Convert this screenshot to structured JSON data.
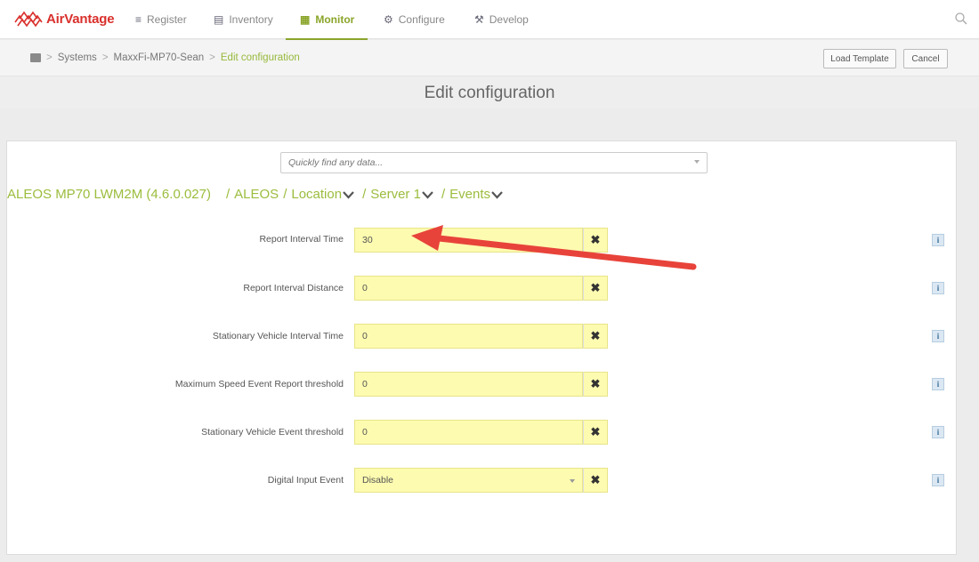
{
  "nav": {
    "logo": "AirVantage",
    "items": [
      {
        "label": "Register",
        "icon": "register-icon"
      },
      {
        "label": "Inventory",
        "icon": "inventory-icon"
      },
      {
        "label": "Monitor",
        "icon": "monitor-icon",
        "active": true
      },
      {
        "label": "Configure",
        "icon": "gear-icon"
      },
      {
        "label": "Develop",
        "icon": "tools-icon"
      }
    ],
    "search_icon": "search-icon",
    "accent_color": "#8aa52a",
    "brand_color": "#d9302c"
  },
  "breadcrumb": {
    "items": [
      "Systems",
      "MaxxFi-MP70-Sean"
    ],
    "current": "Edit configuration",
    "separator": ">"
  },
  "actions": {
    "load_template": "Load Template",
    "cancel": "Cancel"
  },
  "page_title": "Edit configuration",
  "search": {
    "placeholder": "Quickly find any data..."
  },
  "path": {
    "root": "ALEOS MP70 LWM2M (4.6.0.027)",
    "segments": [
      "ALEOS",
      "Location",
      "Server 1",
      "Events"
    ]
  },
  "fields": [
    {
      "label": "Report Interval Time",
      "value": "30"
    },
    {
      "label": "Report Interval Distance",
      "value": "0"
    },
    {
      "label": "Stationary Vehicle Interval Time",
      "value": "0"
    },
    {
      "label": "Maximum Speed Event Report threshold",
      "value": "0"
    },
    {
      "label": "Stationary Vehicle Event threshold",
      "value": "0"
    },
    {
      "label": "Digital Input Event",
      "value": "Disable",
      "type": "select"
    }
  ],
  "field_color": "#fdfbb0",
  "annotation_color": "#e8433a"
}
